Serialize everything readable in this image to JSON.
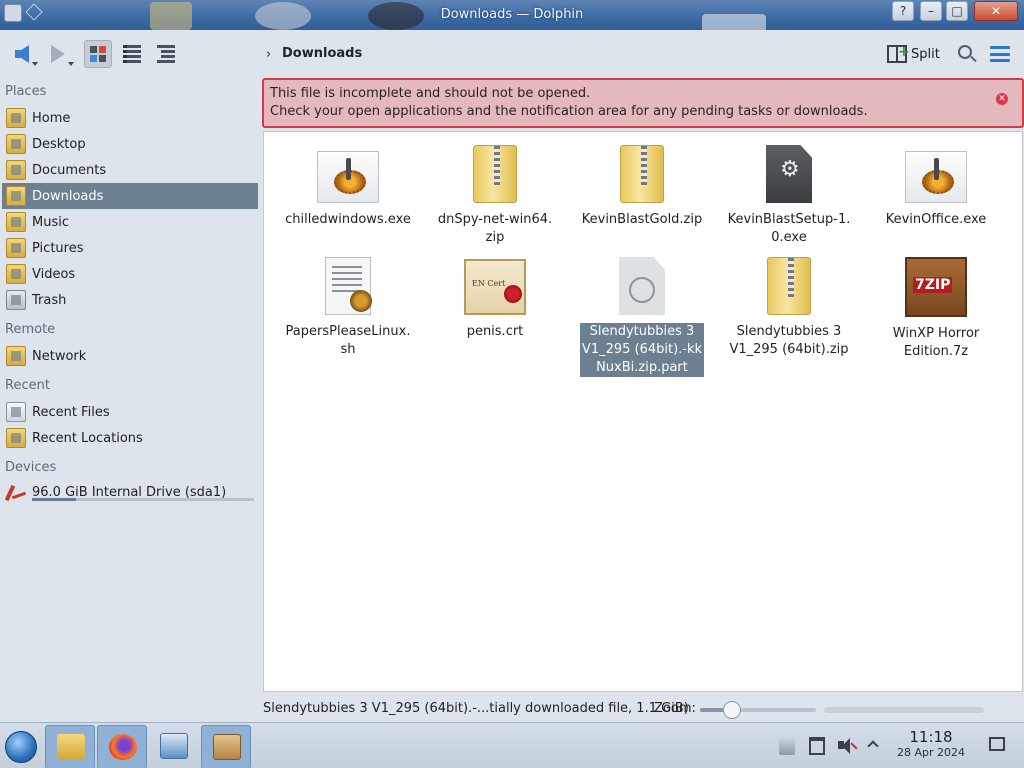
{
  "window": {
    "title": "Downloads — Dolphin",
    "controls": [
      "?",
      "–",
      "□",
      "✕"
    ]
  },
  "toolbar": {
    "breadcrumb_separator": "›",
    "breadcrumb": "Downloads",
    "split_label": "Split"
  },
  "sidebar": {
    "sections": [
      {
        "heading": "Places",
        "items": [
          {
            "label": "Home",
            "icon": "home-folder-icon"
          },
          {
            "label": "Desktop",
            "icon": "desktop-folder-icon"
          },
          {
            "label": "Documents",
            "icon": "documents-folder-icon"
          },
          {
            "label": "Downloads",
            "icon": "downloads-folder-icon",
            "active": true
          },
          {
            "label": "Music",
            "icon": "music-folder-icon"
          },
          {
            "label": "Pictures",
            "icon": "pictures-folder-icon"
          },
          {
            "label": "Videos",
            "icon": "videos-folder-icon"
          },
          {
            "label": "Trash",
            "icon": "trash-icon"
          }
        ]
      },
      {
        "heading": "Remote",
        "items": [
          {
            "label": "Network",
            "icon": "network-folder-icon"
          }
        ]
      },
      {
        "heading": "Recent",
        "items": [
          {
            "label": "Recent Files",
            "icon": "recent-files-icon"
          },
          {
            "label": "Recent Locations",
            "icon": "recent-locations-icon"
          }
        ]
      },
      {
        "heading": "Devices",
        "items": [
          {
            "label": "96.0 GiB Internal Drive (sda1)",
            "icon": "hard-drive-icon",
            "usage_fraction": 0.2
          }
        ]
      }
    ]
  },
  "notice": {
    "line1": "This file is incomplete and should not be opened.",
    "line2": "Check your open applications and the notification area for any pending tasks or downloads."
  },
  "files": [
    {
      "name": "chilledwindows.exe",
      "icon": "executable-icon"
    },
    {
      "name": "dnSpy-net-win64.\nzip",
      "icon": "zip-archive-icon"
    },
    {
      "name": "KevinBlastGold.zip",
      "icon": "zip-archive-icon"
    },
    {
      "name": "KevinBlastSetup-1.\n0.exe",
      "icon": "setup-gear-icon"
    },
    {
      "name": "KevinOffice.exe",
      "icon": "executable-icon"
    },
    {
      "name": "PapersPleaseLinux.\nsh",
      "icon": "shell-script-icon"
    },
    {
      "name": "penis.crt",
      "icon": "certificate-icon"
    },
    {
      "name": "Slendytubbies 3\nV1_295 (64bit).-kk\nNuxBi.zip.part",
      "icon": "partial-download-clock-icon",
      "selected": true
    },
    {
      "name": "Slendytubbies 3\nV1_295 (64bit).zip",
      "icon": "zip-archive-icon"
    },
    {
      "name": "WinXP Horror\nEdition.7z",
      "icon": "7zip-archive-icon"
    }
  ],
  "status": {
    "text": "Slendytubbies 3 V1_295 (64bit).-...tially downloaded file, 1.1 GiB)",
    "zoom_label": "Zoom:",
    "zoom_level_fraction": 0.28
  },
  "taskbar": {
    "apps": [
      "file-manager-icon",
      "firefox-icon",
      "system-monitor-icon",
      "package-installer-icon"
    ],
    "time": "11:18",
    "date": "28 Apr 2024",
    "tray": [
      "clipboard-icon",
      "notes-icon",
      "volume-muted-icon",
      "chevron-up-icon"
    ]
  },
  "colors": {
    "selection": "#6d8092",
    "notice_bg": "#e3b9be",
    "notice_border": "#d33a46",
    "titlebar": "#3d6aa3"
  }
}
